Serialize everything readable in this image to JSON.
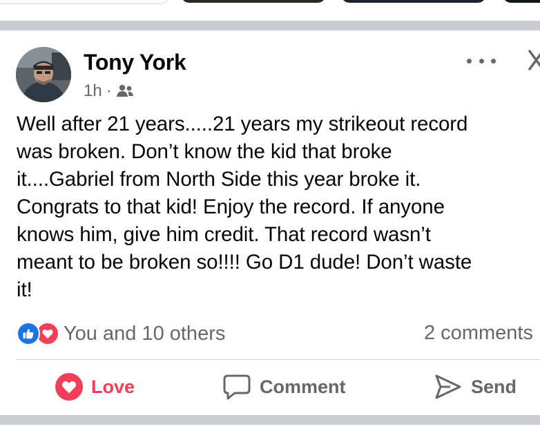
{
  "post": {
    "author": "Tony York",
    "time": "1h",
    "separator": "·",
    "audience_icon": "friends-icon",
    "text_lines": [
      "Well after 21 years.....21 years my strikeout record",
      "was broken. Don’t know the kid that broke",
      "it....Gabriel from North Side this year broke it.",
      "Congrats to that kid! Enjoy the record. If anyone",
      "knows him, give him credit. That record wasn’t",
      "meant to be broken so!!!! Go D1 dude! Don’t waste",
      "it!"
    ]
  },
  "reactions": {
    "summary": "You and 10 others",
    "comments": "2 comments",
    "icons": [
      "like-icon",
      "love-icon"
    ]
  },
  "actions": {
    "love_label": "Love",
    "comment_label": "Comment",
    "send_label": "Send"
  },
  "colors": {
    "like_blue": "#1b74e4",
    "love_red": "#f33e58",
    "secondary_text": "#65676b",
    "divider_band": "#c9ccd1"
  }
}
